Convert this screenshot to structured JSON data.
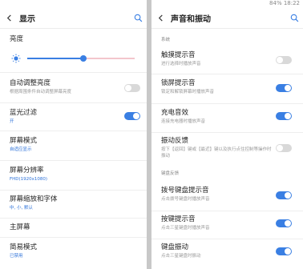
{
  "left": {
    "title": "显示",
    "brightness": {
      "label": "亮度",
      "level": 0.52
    },
    "items": [
      {
        "title": "自动调整亮度",
        "subtitle": "根据周围条件自动调整屏幕亮度",
        "toggle": "off"
      },
      {
        "title": "蓝光过滤",
        "subtitle": "开",
        "toggle": "on"
      },
      {
        "title": "屏幕模式",
        "subtitle": "自适应显示"
      },
      {
        "title": "屏幕分辨率",
        "subtitle": "FHD(1920x1080)"
      },
      {
        "title": "屏幕缩放和字体",
        "subtitle": "中, 小, 默认"
      },
      {
        "title": "主屏幕"
      },
      {
        "title": "简易模式",
        "subtitle": "已禁用"
      }
    ]
  },
  "right": {
    "status_text": "84% 18:22",
    "title": "声音和振动",
    "section_system": "系统",
    "section_keyboard": "键盘反馈",
    "items": [
      {
        "title": "触摸提示音",
        "subtitle": "进行选择时播放声音",
        "toggle": "off"
      },
      {
        "title": "锁屏提示音",
        "subtitle": "锁定和解锁屏幕时播放声音",
        "toggle": "on"
      },
      {
        "title": "充电音效",
        "subtitle": "连接充电器时播放声音",
        "toggle": "on"
      },
      {
        "title": "振动反馈",
        "subtitle": "按下【返回】键或【最近】键以及执行点住控制等操作时振动",
        "toggle": "off"
      },
      {
        "title": "拨号键盘提示音",
        "subtitle": "点击拨号键盘时播放声音",
        "toggle": "on"
      },
      {
        "title": "按键提示音",
        "subtitle": "点击三星键盘时播放声音",
        "toggle": "on"
      },
      {
        "title": "键盘振动",
        "subtitle": "点击三星键盘时振动",
        "toggle": "on"
      }
    ]
  },
  "colors": {
    "accent": "#3a7fe3",
    "toggle_off": "#d9d9d9",
    "subtitle_blue": "#2d72d9",
    "slider_right_track": "#f3c6cc",
    "sun_icon": "#3a7fe3"
  }
}
